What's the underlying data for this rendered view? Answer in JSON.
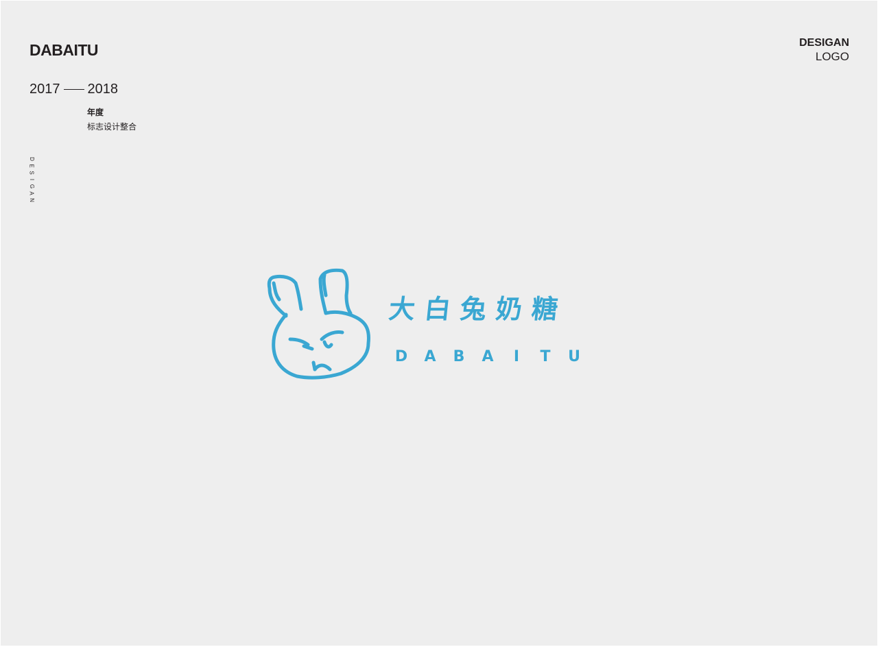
{
  "brand": {
    "title": "DABAITU"
  },
  "years": {
    "start": "2017",
    "end": "2018"
  },
  "annual_label": "年度",
  "subtitle": "标志设计整合",
  "vertical_label": [
    "D",
    "E",
    "S",
    "I",
    "G",
    "A",
    "N"
  ],
  "corner": {
    "line1": "DESIGAN",
    "line2": "LOGO"
  },
  "logo": {
    "chinese": [
      "大",
      "白",
      "兔",
      "奶",
      "糖"
    ],
    "latin": [
      "D",
      "A",
      "B",
      "A",
      "I",
      "T",
      "U"
    ],
    "icon": "rabbit-face-icon",
    "color": "#3aa7d2"
  },
  "colors": {
    "background": "#eeeeee",
    "text": "#231f20",
    "accent": "#3aa7d2"
  }
}
